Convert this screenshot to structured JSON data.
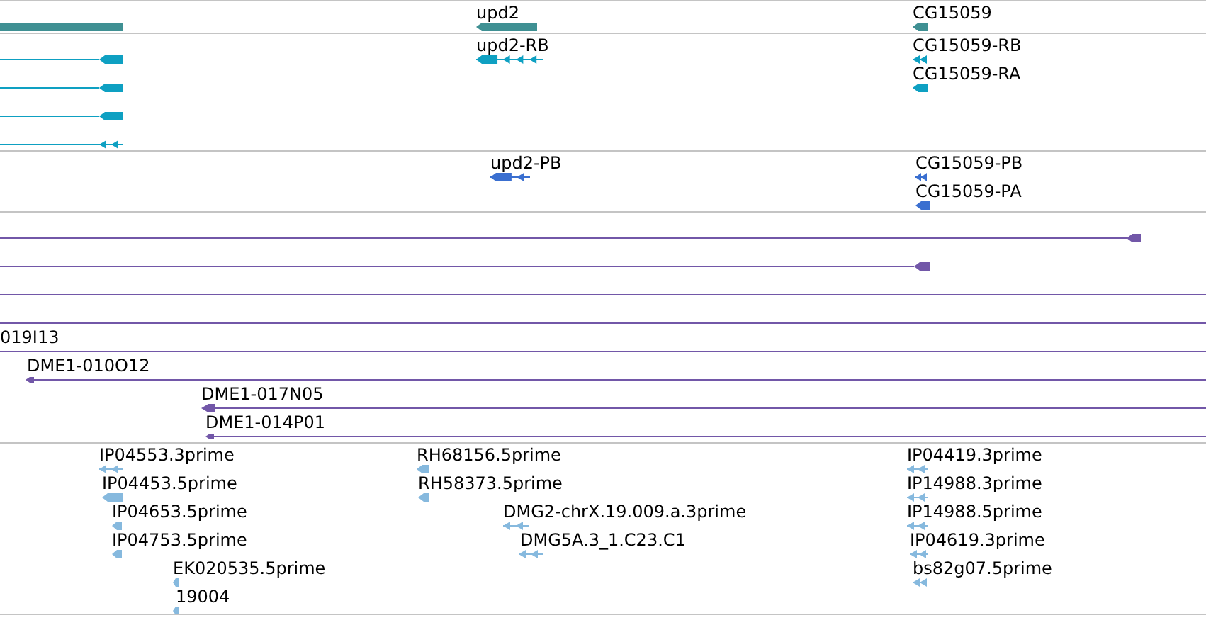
{
  "tracks": [
    {
      "color": "#3f9093",
      "features": [
        {
          "kind": "bar"
        },
        {
          "kind": "block",
          "label": "upd2"
        },
        {
          "kind": "block",
          "label": "CG15059"
        }
      ]
    },
    {
      "color": "#0ea0c2",
      "features": [
        {
          "kind": "line"
        },
        {
          "kind": "line"
        },
        {
          "kind": "line"
        },
        {
          "kind": "split"
        },
        {
          "kind": "split",
          "label": "upd2-RB"
        },
        {
          "kind": "split",
          "label": "CG15059-RB"
        },
        {
          "kind": "block",
          "label": "CG15059-RA"
        }
      ]
    },
    {
      "color": "#3a6fd0",
      "features": [
        {
          "kind": "split",
          "label": "upd2-PB"
        },
        {
          "kind": "split",
          "label": "CG15059-PB"
        },
        {
          "kind": "block",
          "label": "CG15059-PA"
        }
      ]
    },
    {
      "color": "#7257a8",
      "features": [
        {
          "kind": "line"
        },
        {
          "kind": "line"
        },
        {
          "kind": "line"
        },
        {
          "kind": "line"
        },
        {
          "kind": "line",
          "label": "019I13"
        },
        {
          "kind": "clone",
          "label": "DME1-010O12"
        },
        {
          "kind": "clone",
          "label": "DME1-017N05"
        },
        {
          "kind": "clone",
          "label": "DME1-014P01"
        }
      ]
    },
    {
      "color": "#86b9de",
      "features": [
        {
          "kind": "split",
          "label": "IP04553.3prime"
        },
        {
          "kind": "block",
          "label": "IP04453.5prime"
        },
        {
          "kind": "block",
          "label": "IP04653.5prime"
        },
        {
          "kind": "block",
          "label": "IP04753.5prime"
        },
        {
          "kind": "block",
          "label": "EK020535.5prime"
        },
        {
          "kind": "block",
          "label": "19004"
        },
        {
          "kind": "block",
          "label": "RH68156.5prime"
        },
        {
          "kind": "block",
          "label": "RH58373.5prime"
        },
        {
          "kind": "split",
          "label": "DMG2-chrX.19.009.a.3prime"
        },
        {
          "kind": "split",
          "label": "DMG5A.3_1.C23.C1"
        },
        {
          "kind": "split",
          "label": "IP04419.3prime"
        },
        {
          "kind": "split",
          "label": "IP14988.3prime"
        },
        {
          "kind": "split",
          "label": "IP14988.5prime"
        },
        {
          "kind": "split",
          "label": "IP04619.3prime"
        },
        {
          "kind": "split",
          "label": "bs82g07.5prime"
        }
      ]
    }
  ]
}
